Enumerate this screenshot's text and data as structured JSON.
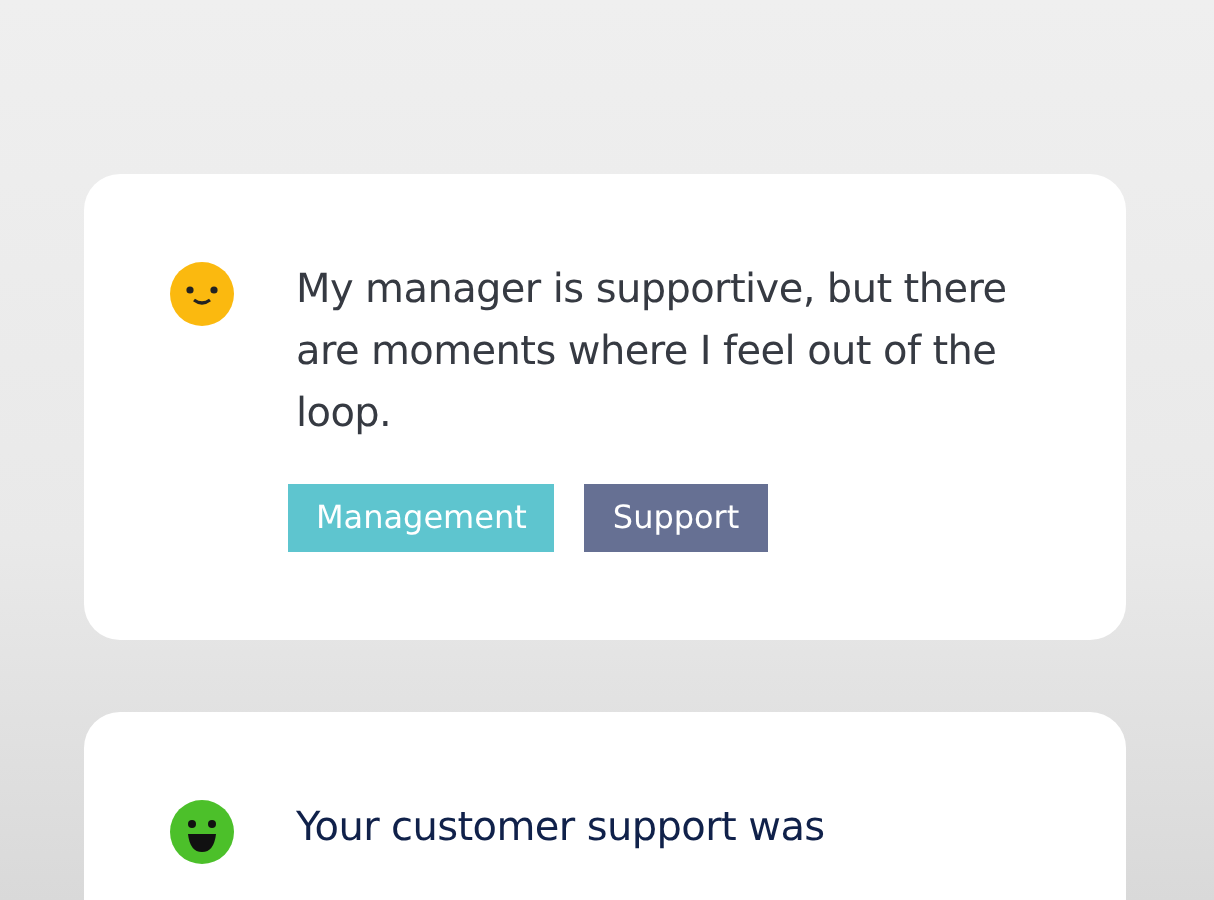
{
  "cards": [
    {
      "kind": "neutral",
      "text": "My manager is supportive, but there are moments where I feel out of the loop.",
      "tags": [
        {
          "label": "Management",
          "color": "#5ec5cf"
        },
        {
          "label": "Support",
          "color": "#667093"
        }
      ]
    },
    {
      "kind": "happy",
      "text": "Your customer support was"
    }
  ]
}
